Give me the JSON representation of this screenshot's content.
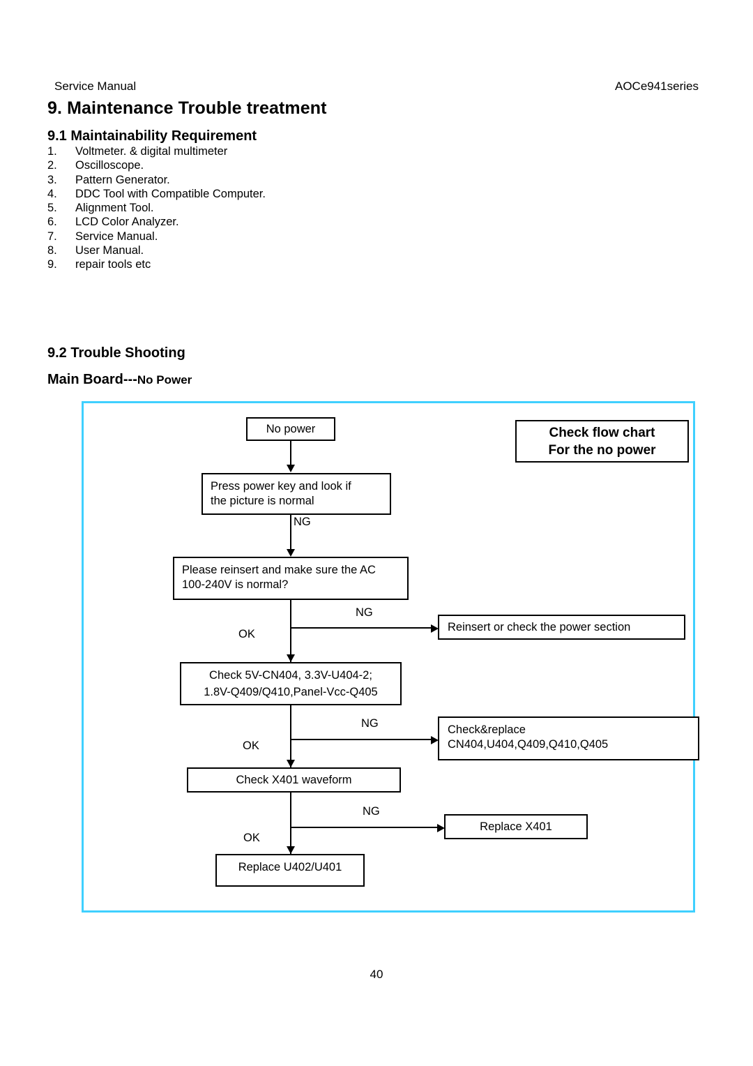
{
  "header": {
    "left": "Service Manual",
    "right": "AOCe941series"
  },
  "chapter": {
    "title": "9. Maintenance Trouble treatment"
  },
  "section_91": {
    "title": "9.1 Maintainability Requirement",
    "items": [
      {
        "num": "1.",
        "text": "Voltmeter. & digital multimeter"
      },
      {
        "num": "2.",
        "text": "Oscilloscope."
      },
      {
        "num": "3.",
        "text": "Pattern Generator."
      },
      {
        "num": "4.",
        "text": "DDC Tool with Compatible Computer."
      },
      {
        "num": "5.",
        "text": "Alignment Tool."
      },
      {
        "num": "6.",
        "text": "LCD Color Analyzer."
      },
      {
        "num": "7.",
        "text": "Service Manual."
      },
      {
        "num": "8.",
        "text": "User Manual."
      },
      {
        "num": "9.",
        "text": "repair tools etc"
      }
    ]
  },
  "section_92": {
    "title": "9.2 Trouble Shooting",
    "subtitle_main": "Main Board---",
    "subtitle_sub": "No Power"
  },
  "flowchart": {
    "frame_color": "#3fd0ff",
    "title_box": {
      "line1": "Check flow chart",
      "line2": "For the no power"
    },
    "nodes": {
      "no_power": "No power",
      "press_power_l1": "Press power key and look if",
      "press_power_l2": "the picture is normal",
      "reinsert_ac_l1": "Please reinsert and make sure the AC",
      "reinsert_ac_l2": "100-240V is normal?",
      "power_section": "Reinsert or check the power section",
      "check_voltages_l1": "Check 5V-CN404, 3.3V-U404-2;",
      "check_voltages_l2": "1.8V-Q409/Q410,Panel-Vcc-Q405",
      "check_replace_l1": "Check&replace",
      "check_replace_l2": "CN404,U404,Q409,Q410,Q405",
      "check_x401": "Check X401 waveform",
      "replace_x401": "Replace X401",
      "replace_u402": "Replace U402/U401"
    },
    "edge_labels": {
      "ng1": "NG",
      "ng2": "NG",
      "ok2": "OK",
      "ng3": "NG",
      "ok3": "OK",
      "ng4": "NG",
      "ok4": "OK"
    }
  },
  "footer": {
    "page_number": "40"
  }
}
